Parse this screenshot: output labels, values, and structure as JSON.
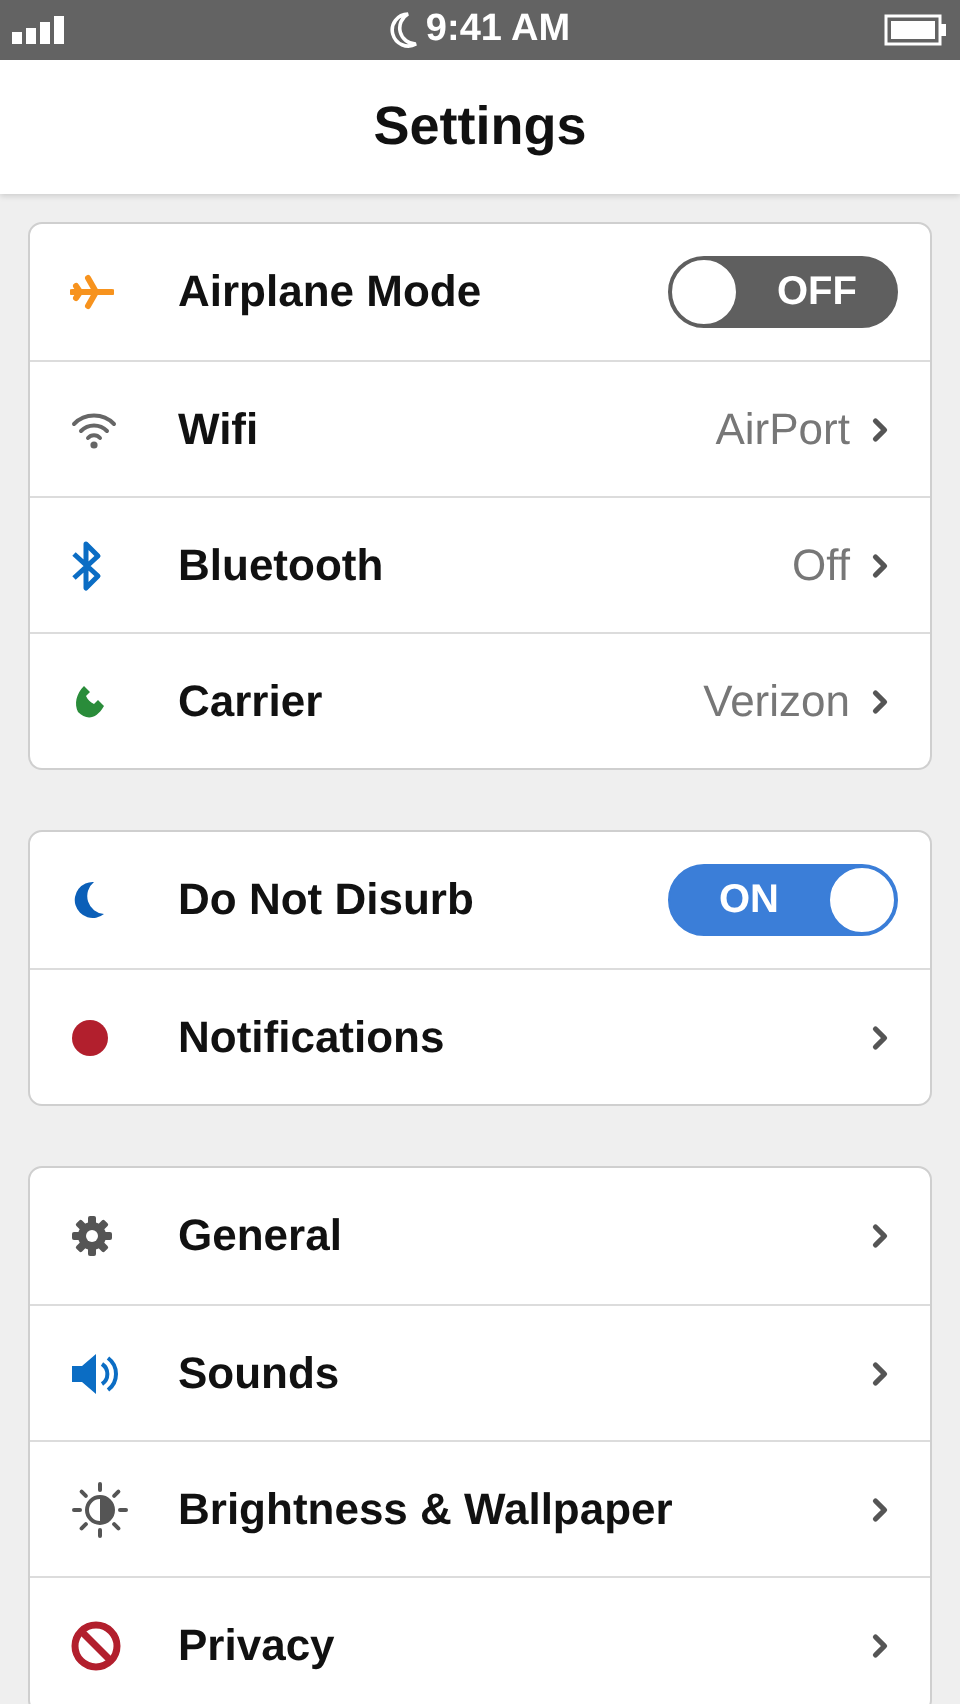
{
  "status_bar": {
    "time": "9:41 AM"
  },
  "nav_bar": {
    "title": "Settings"
  },
  "groups": [
    {
      "rows": [
        {
          "kind": "toggle",
          "label": "Airplane Mode",
          "on": false,
          "toggle_text": "OFF"
        },
        {
          "kind": "link",
          "label": "Wifi",
          "value": "AirPort"
        },
        {
          "kind": "link",
          "label": "Bluetooth",
          "value": "Off"
        },
        {
          "kind": "link",
          "label": "Carrier",
          "value": "Verizon"
        }
      ]
    },
    {
      "rows": [
        {
          "kind": "toggle",
          "label": "Do Not Disurb",
          "on": true,
          "toggle_text": "ON"
        },
        {
          "kind": "link",
          "label": "Notifications"
        }
      ]
    },
    {
      "rows": [
        {
          "kind": "link",
          "label": "General"
        },
        {
          "kind": "link",
          "label": "Sounds"
        },
        {
          "kind": "link",
          "label": "Brightness & Wallpaper"
        },
        {
          "kind": "link",
          "label": "Privacy"
        }
      ]
    }
  ]
}
